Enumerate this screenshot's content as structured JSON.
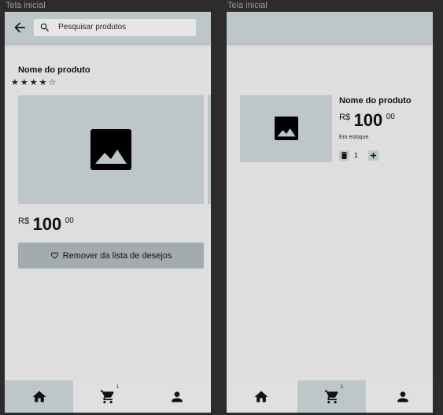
{
  "frames": [
    {
      "label": "Tela inicial"
    },
    {
      "label": "Tela inicial"
    }
  ],
  "search": {
    "placeholder": "Pesquisar produtos"
  },
  "product": {
    "name": "Nome do produto",
    "rating": 4,
    "rating_max": 5,
    "stars": "★★★★☆",
    "price_currency": "R$",
    "price_int": "100",
    "price_cents": "00"
  },
  "wishlist_button": {
    "label": "Remover da lista de desejos"
  },
  "cart": {
    "stock_status": "Em estoque",
    "quantity": "1",
    "badge": "1"
  },
  "nav": {
    "items": [
      {
        "name": "home",
        "icon": "home-icon"
      },
      {
        "name": "cart",
        "icon": "cart-icon"
      },
      {
        "name": "profile",
        "icon": "user-icon"
      }
    ],
    "active_left": "home",
    "active_right": "cart"
  },
  "colors": {
    "accent": "#bdc7c9",
    "button": "#a2abad",
    "background": "#dedede"
  }
}
